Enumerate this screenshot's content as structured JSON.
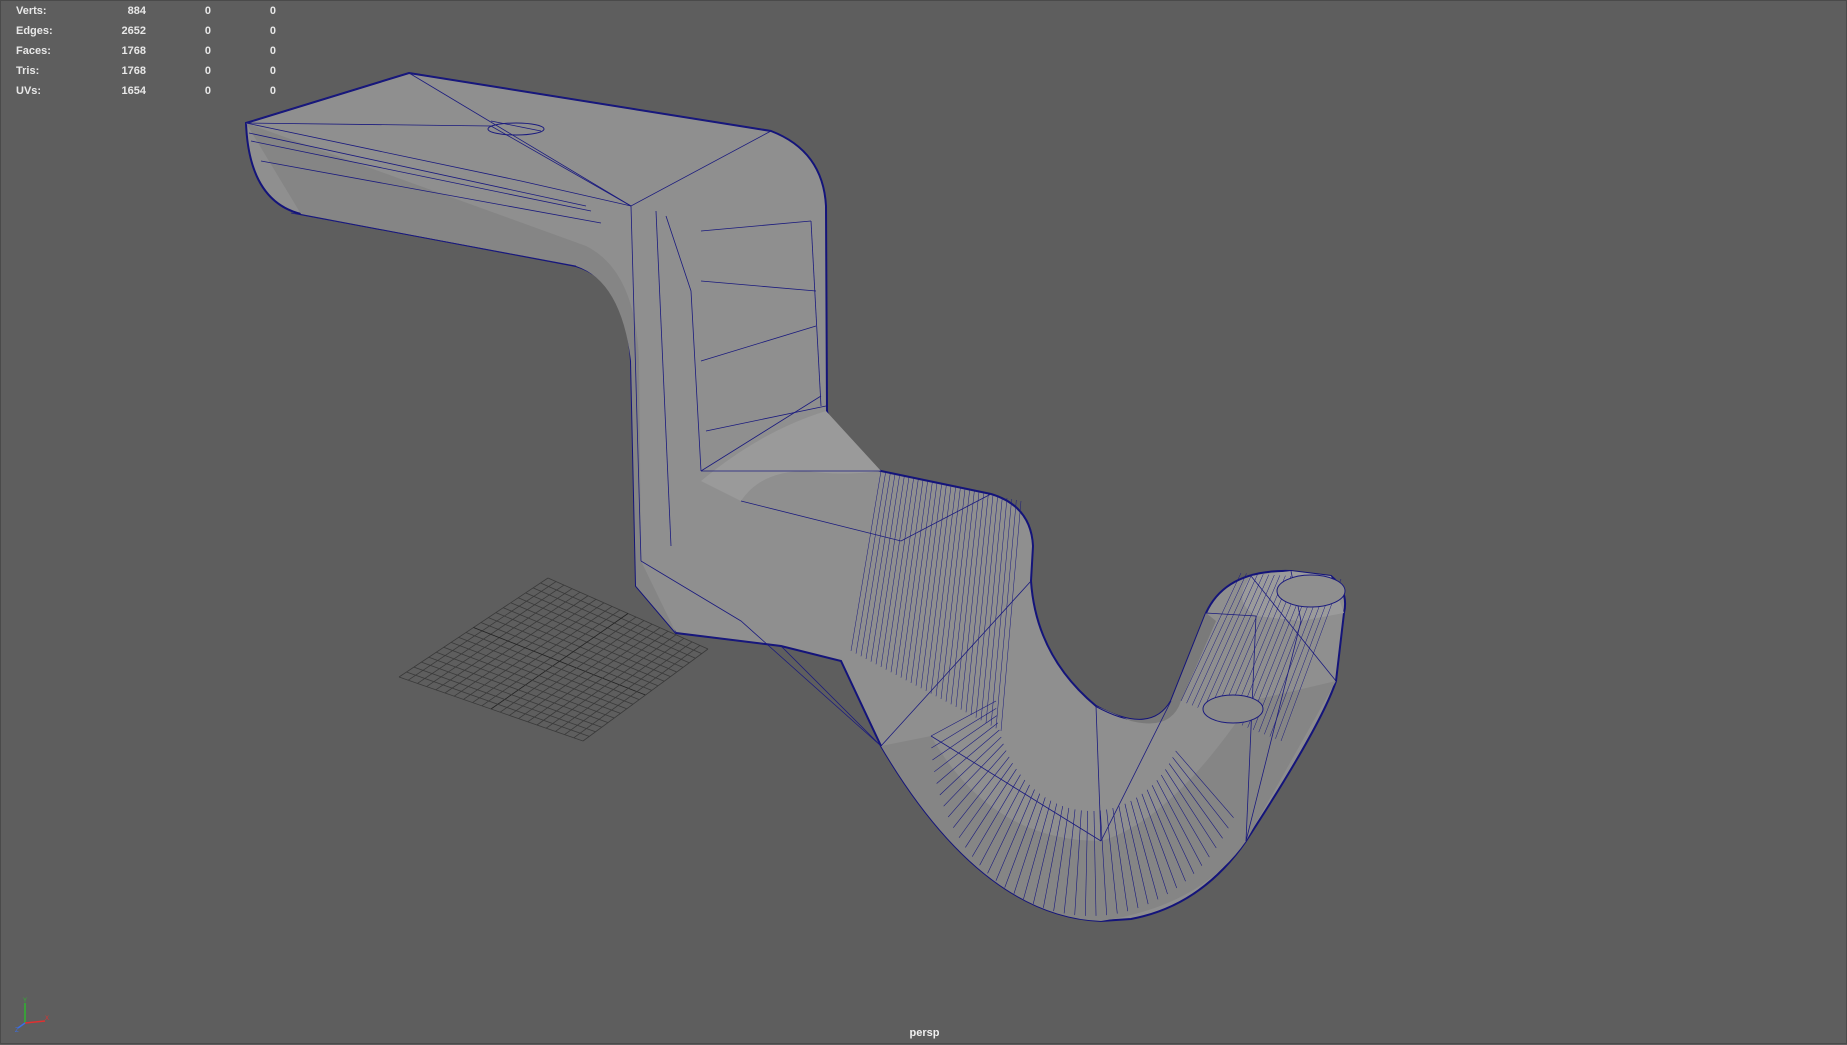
{
  "hud": {
    "rows": [
      {
        "label": "Verts:",
        "v1": "884",
        "v2": "0",
        "v3": "0"
      },
      {
        "label": "Edges:",
        "v1": "2652",
        "v2": "0",
        "v3": "0"
      },
      {
        "label": "Faces:",
        "v1": "1768",
        "v2": "0",
        "v3": "0"
      },
      {
        "label": "Tris:",
        "v1": "1768",
        "v2": "0",
        "v3": "0"
      },
      {
        "label": "UVs:",
        "v1": "1654",
        "v2": "0",
        "v3": "0"
      }
    ]
  },
  "camera": {
    "name": "persp"
  },
  "axis": {
    "y": "Y",
    "x": "X",
    "z": "Z"
  },
  "colors": {
    "background": "#5e5e5e",
    "mesh_fill": "#8f8f8f",
    "wireframe": "#1a1a7e",
    "grid": "#333333",
    "hud_text": "#e8e8e8"
  }
}
